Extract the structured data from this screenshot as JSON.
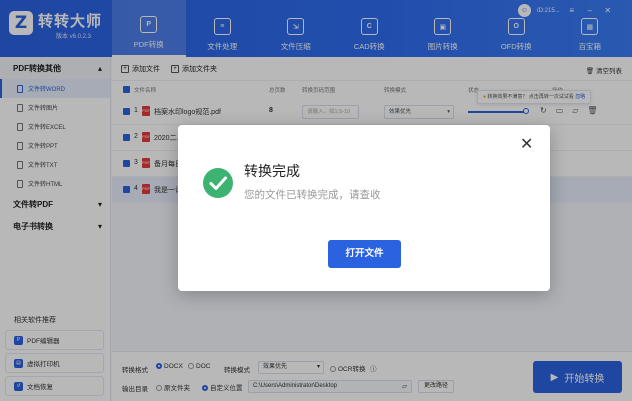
{
  "app": {
    "title": "转转大师",
    "version": "版本 v6.0.2.3",
    "logo_letter": "Z",
    "user_id": "ID:215...",
    "accent": "#2b62e0"
  },
  "nav": [
    {
      "label": "PDF转换",
      "icon": "pdf-convert-icon",
      "glyph": "P",
      "active": true
    },
    {
      "label": "文件处理",
      "icon": "file-process-icon",
      "glyph": "≡"
    },
    {
      "label": "文件压缩",
      "icon": "compress-icon",
      "glyph": "⇲"
    },
    {
      "label": "CAD转换",
      "icon": "cad-icon",
      "glyph": "C"
    },
    {
      "label": "图片转换",
      "icon": "image-icon",
      "glyph": "▣"
    },
    {
      "label": "OFD转换",
      "icon": "ofd-icon",
      "glyph": "O"
    },
    {
      "label": "百宝箱",
      "icon": "toolbox-icon",
      "glyph": "▦"
    }
  ],
  "sidebar": {
    "group1": "PDF转换其他",
    "items": [
      "文件转WORD",
      "文件转图片",
      "文件转EXCEL",
      "文件转PPT",
      "文件转TXT",
      "文件转HTML"
    ],
    "group2": "文件转PDF",
    "group3": "电子书转换",
    "rec_title": "相关软件推荐",
    "rec": [
      "PDF编辑器",
      "虚拟打印机",
      "文档恢复"
    ]
  },
  "toolbar": {
    "add_file": "添加文件",
    "add_folder": "添加文件夹",
    "clear": "清空列表"
  },
  "table": {
    "col_name": "文件名称",
    "col_pages": "总页数",
    "col_range": "转换页码范围",
    "col_mode": "转换模式",
    "col_status": "状态",
    "col_ops": "操作",
    "rows": [
      {
        "num": "1",
        "name": "档案水印logo规范.pdf",
        "pages": "8",
        "range_placeholder": "请输入，如1,5-10",
        "mode": "效果优先"
      },
      {
        "num": "2",
        "name": "2020二..."
      },
      {
        "num": "3",
        "name": "备月每日..."
      },
      {
        "num": "4",
        "name": "我是一计..."
      }
    ]
  },
  "tooltip": {
    "prefix": "转换效果不满意？",
    "highlight": "点击再转一次试试看",
    "link": "忽略"
  },
  "bottom": {
    "format_label": "转换格式",
    "docx": "DOCX",
    "doc": "DOC",
    "mode_label": "转换模式",
    "mode_value": "效果优先",
    "ocr": "OCR转换",
    "output_label": "输出目录",
    "origin": "原文件夹",
    "custom": "自定义位置",
    "path": "C:\\Users\\Administrator\\Desktop",
    "change_path": "更改路径",
    "start": "开始转换"
  },
  "dialog": {
    "title": "转换完成",
    "message": "您的文件已转换完成，请查收",
    "button": "打开文件",
    "success_color": "#3cb371"
  }
}
